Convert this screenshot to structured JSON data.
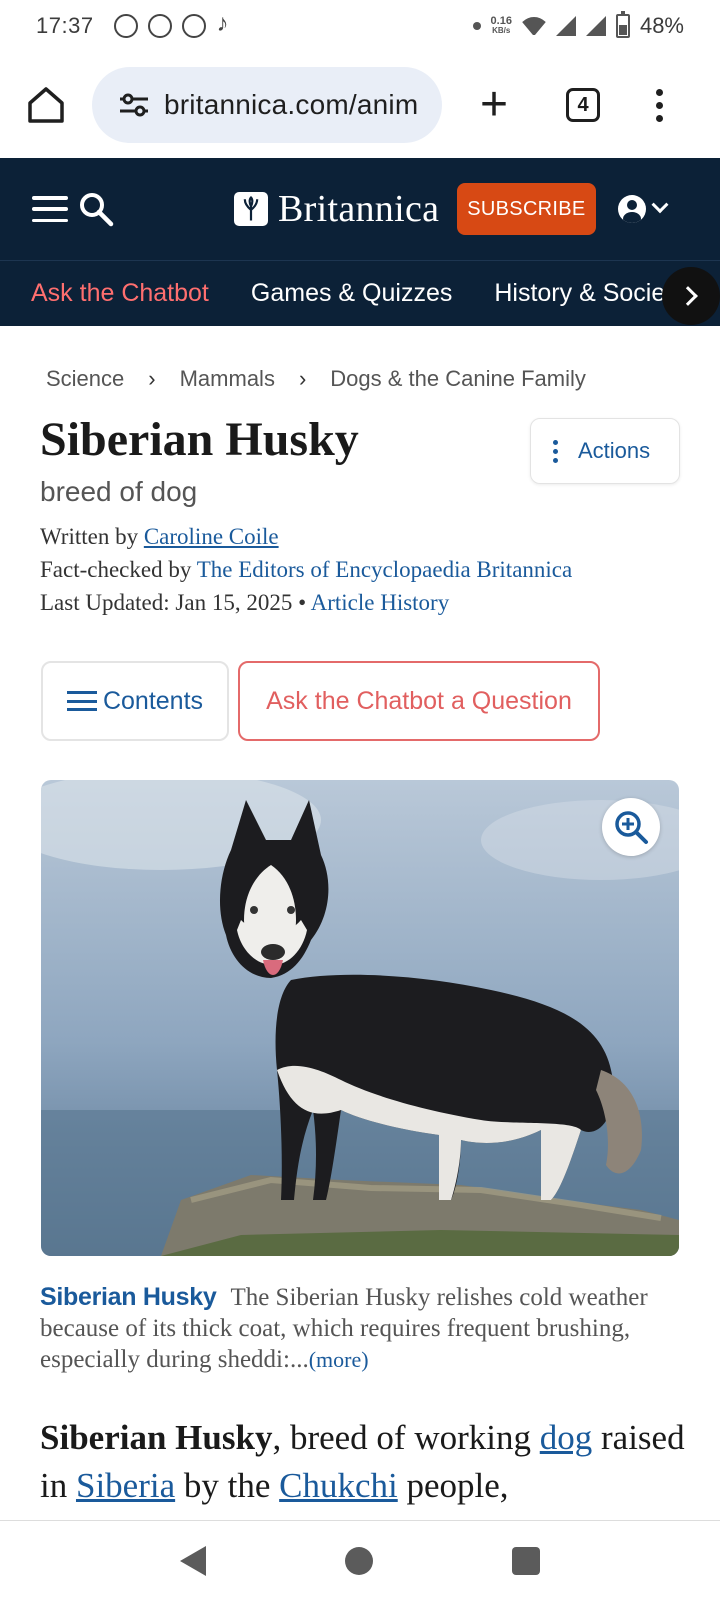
{
  "status_bar": {
    "time": "17:37",
    "net_speed": "0.16",
    "net_unit": "KB/s",
    "battery": "48%"
  },
  "browser": {
    "url": "britannica.com/anim",
    "tab_count": "4"
  },
  "header": {
    "logo_text": "Britannica",
    "subscribe_label": "SUBSCRIBE"
  },
  "nav": {
    "items": [
      "Ask the Chatbot",
      "Games & Quizzes",
      "History & Society"
    ]
  },
  "breadcrumb": [
    "Science",
    "Mammals",
    "Dogs & the Canine Family"
  ],
  "article": {
    "title": "Siberian Husky",
    "subtitle": "breed of dog",
    "actions_label": "Actions",
    "written_by_label": "Written by",
    "author": "Caroline Coile",
    "fact_checked_label": "Fact-checked by",
    "fact_checker": "The Editors of Encyclopaedia Britannica",
    "last_updated_label": "Last Updated: Jan 15, 2025 •",
    "article_history": "Article History",
    "contents_label": "Contents",
    "ask_label": "Ask the Chatbot a Question",
    "caption_title": "Siberian Husky",
    "caption_text": "The Siberian Husky relishes cold weather because of its thick coat, which requires frequent brushing, especially during sheddi:...",
    "caption_more": "(more)",
    "body": {
      "lead_bold": "Siberian Husky",
      "t1": ", breed of working ",
      "link1": "dog",
      "t2": " raised in ",
      "link2": "Siberia",
      "t3": " by the ",
      "link3": "Chukchi",
      "t4": " people,"
    }
  },
  "colors": {
    "header_bg": "#0c2137",
    "subscribe": "#d74914",
    "link": "#1a5a9b",
    "chatbot_red": "#e15f5f"
  },
  "icons": [
    "home-icon",
    "tune-icon",
    "plus-icon",
    "menu-icon",
    "search-icon",
    "user-icon",
    "chevron-right-icon",
    "zoom-in-icon",
    "contents-icon",
    "kebab-icon"
  ]
}
